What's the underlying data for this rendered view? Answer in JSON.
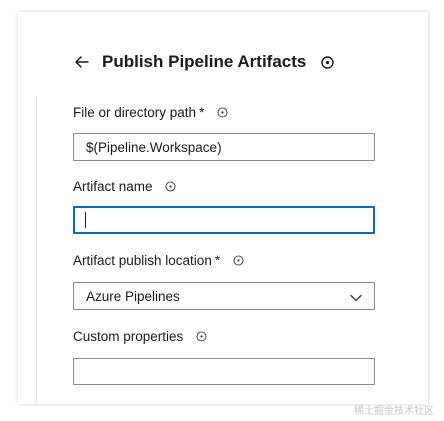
{
  "header": {
    "title": "Publish Pipeline Artifacts",
    "back_icon": "arrow-left-icon",
    "info_icon": "info-icon"
  },
  "fields": {
    "path": {
      "label": "File or directory path",
      "required_mark": "*",
      "value": "$(Pipeline.Workspace)"
    },
    "artifact_name": {
      "label": "Artifact name",
      "value": ""
    },
    "publish_location": {
      "label": "Artifact publish location",
      "required_mark": "*",
      "value": "Azure Pipelines",
      "icon": "chevron-down-icon"
    },
    "custom_properties": {
      "label": "Custom properties",
      "value": ""
    }
  },
  "watermark": "稀土掘金技术社区",
  "colors": {
    "focus_border": "#0f6cbd",
    "input_border": "#8a8a8a",
    "text": "#1b1b1b"
  }
}
